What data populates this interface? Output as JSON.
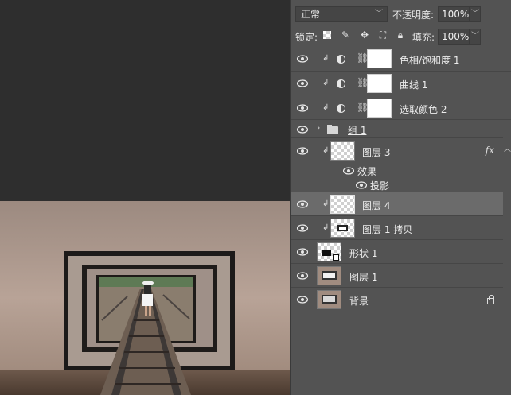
{
  "blend_mode": "正常",
  "opacity": {
    "label": "不透明度:",
    "value": "100%"
  },
  "lock": {
    "label": "锁定:"
  },
  "fill": {
    "label": "填充:",
    "value": "100%"
  },
  "layers": [
    {
      "name": "色相/饱和度 1",
      "kind": "adjustment"
    },
    {
      "name": "曲线 1",
      "kind": "adjustment"
    },
    {
      "name": "选取颜色 2",
      "kind": "adjustment"
    },
    {
      "name": "组 1",
      "kind": "group"
    },
    {
      "name": "图层 3",
      "kind": "pixel",
      "fx": "fx"
    },
    {
      "name": "效果",
      "kind": "effects-header"
    },
    {
      "name": "投影",
      "kind": "effect"
    },
    {
      "name": "图层 4",
      "kind": "pixel",
      "selected": true
    },
    {
      "name": "图层 1 拷贝",
      "kind": "pixel"
    },
    {
      "name": "形状 1",
      "kind": "shape"
    },
    {
      "name": "图层 1",
      "kind": "pixel"
    },
    {
      "name": "背景",
      "kind": "background",
      "locked": true
    }
  ],
  "colors": {
    "panel": "#535353",
    "selected_row": "#6b6b6b",
    "canvas_bg": "#2e2e2e"
  }
}
